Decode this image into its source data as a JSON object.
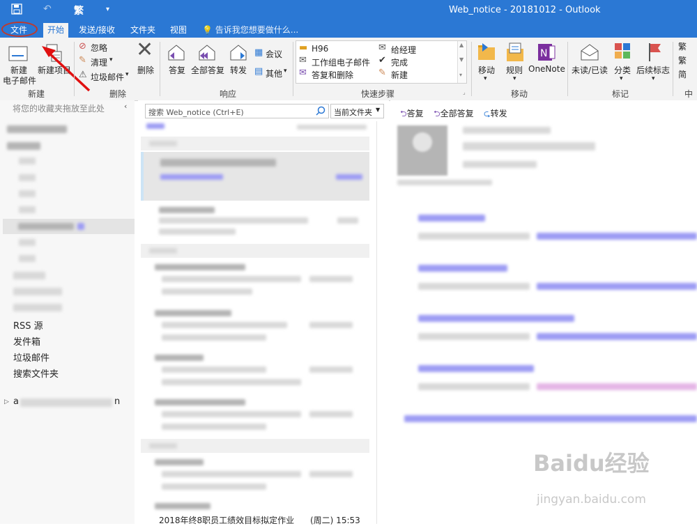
{
  "window": {
    "title": "Web_notice - 20181012 - Outlook"
  },
  "quick_access": {
    "save_icon": "save-icon",
    "undo_icon": "undo-icon",
    "convert_label": "繁",
    "more_icon": "customize-icon"
  },
  "tabs": [
    {
      "label": "文件",
      "annotated": true
    },
    {
      "label": "开始",
      "active": true
    },
    {
      "label": "发送/接收"
    },
    {
      "label": "文件夹"
    },
    {
      "label": "视图"
    }
  ],
  "tellme": {
    "placeholder": "告诉我您想要做什么..."
  },
  "ribbon": {
    "new": {
      "label": "新建",
      "new_email": [
        "新建",
        "电子邮件"
      ],
      "new_items": [
        "新建项目"
      ]
    },
    "delete": {
      "label": "删除",
      "ignore": "忽略",
      "cleanup": "清理",
      "junk": "垃圾邮件",
      "delete": "删除"
    },
    "respond": {
      "label": "响应",
      "reply": "答复",
      "reply_all": "全部答复",
      "forward": "转发",
      "meeting": "会议",
      "more": "其他"
    },
    "quicksteps": {
      "label": "快速步骤",
      "items": [
        "H96",
        "给经理",
        "工作组电子邮件",
        "完成",
        "答复和删除",
        "新建"
      ]
    },
    "move": {
      "label": "移动",
      "move": "移动",
      "rules": "规则",
      "onenote": "OneNote"
    },
    "tags": {
      "label": "标记",
      "unread": "未读/已读",
      "categorize": "分类",
      "followup": "后续标志"
    },
    "chinese": {
      "label": "中文",
      "items": [
        "繁",
        "繁",
        "简"
      ]
    }
  },
  "folder_pane": {
    "drag_hint": "将您的收藏夹拖放至此处",
    "folders": [
      "RSS 源",
      "发件箱",
      "垃圾邮件",
      "搜索文件夹"
    ],
    "account_initial": "a",
    "account_end": "n"
  },
  "message_list": {
    "search_placeholder": "搜索 Web_notice (Ctrl+E)",
    "scope": "当前文件夹",
    "last_item": {
      "subject": "2018年终8职员工绩效目标拟定作业",
      "date": "(周二) 15:53"
    }
  },
  "reading_pane": {
    "reply": "答复",
    "reply_all": "全部答复",
    "forward": "转发"
  },
  "watermark": {
    "logo": "Baidu经验",
    "url": "jingyan.baidu.com"
  },
  "colors": {
    "accent": "#2b78d4",
    "annotation": "#c0392b"
  }
}
